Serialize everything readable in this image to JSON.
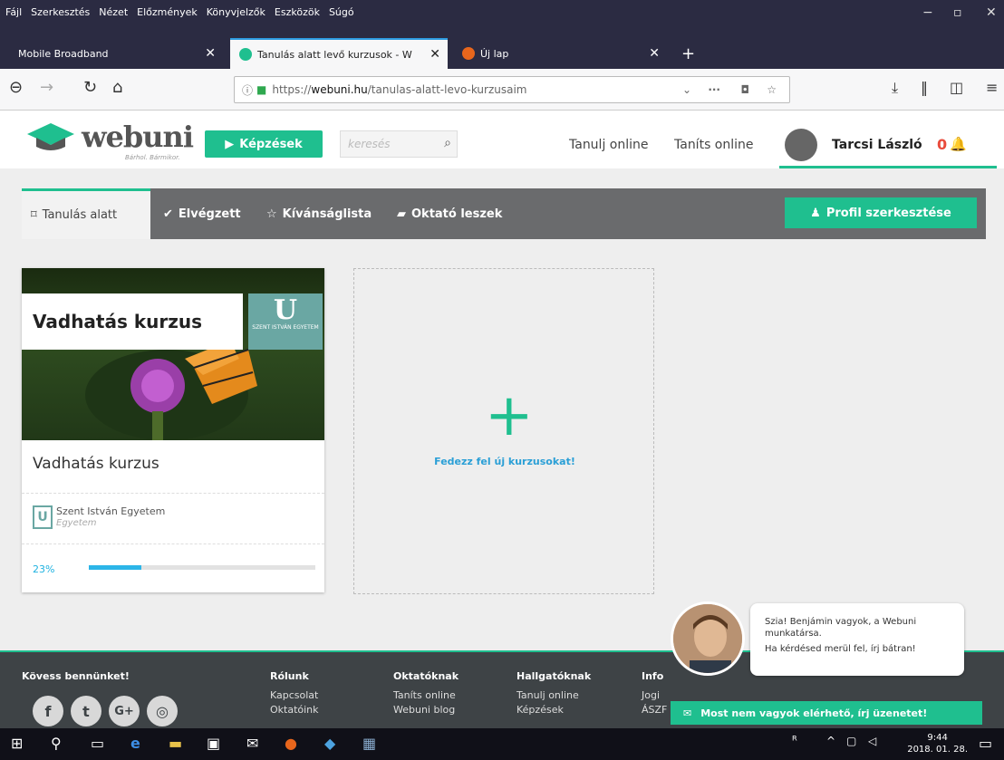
{
  "menubar": {
    "items": [
      "Fájl",
      "Szerkesztés",
      "Nézet",
      "Előzmények",
      "Könyvjelzők",
      "Eszközök",
      "Súgó"
    ],
    "minimize": "−",
    "restore": "▫",
    "close": "✕"
  },
  "tabs": [
    {
      "label": "Mobile Broadband",
      "active": false
    },
    {
      "label": "Tanulás alatt levő kurzusok - W",
      "active": true
    },
    {
      "label": "Új lap",
      "active": false
    }
  ],
  "tab_close": "✕",
  "new_tab": "+",
  "nav": {
    "url_prefix": "https://",
    "url_domain": "webuni.hu",
    "url_path": "/tanulas-alatt-levo-kurzusaim",
    "more": "···"
  },
  "site": {
    "logo": "webuni",
    "logo_sub": "Bárhol. Bármikor.",
    "kepzesek": "Képzések",
    "search_placeholder": "keresés",
    "link1": "Tanulj online",
    "link2": "Taníts online",
    "username": "Tarcsi László",
    "notif_count": "0"
  },
  "coursetabs": [
    {
      "label": "Tanulás alatt",
      "icon": "bookmark-icon"
    },
    {
      "label": "Elvégzett",
      "icon": "check-icon"
    },
    {
      "label": "Kívánságlista",
      "icon": "star-icon"
    },
    {
      "label": "Oktató leszek",
      "icon": "book-icon"
    }
  ],
  "profile_button": "Profil szerkesztése",
  "card": {
    "title": "Vadhatás kurzus",
    "name": "Vadhatás kurzus",
    "uni_logo_text": "SZENT ISTVÁN EGYETEM",
    "org": "Szent István Egyetem",
    "org_type": "Egyetem",
    "progress_label": "23%",
    "progress": 0.23
  },
  "discover": {
    "text": "Fedezz fel új kurzusokat!"
  },
  "footer": {
    "follow": "Kövess bennünket!",
    "cols": [
      {
        "title": "Rólunk",
        "links": [
          "Kapcsolat",
          "Oktatóink"
        ]
      },
      {
        "title": "Oktatóknak",
        "links": [
          "Taníts online",
          "Webuni blog"
        ]
      },
      {
        "title": "Hallgatóknak",
        "links": [
          "Tanulj online",
          "Képzések"
        ]
      },
      {
        "title": "Info",
        "links": [
          "Jogi",
          "ÁSZF"
        ]
      }
    ],
    "social": [
      "f",
      "t",
      "G+",
      "◎"
    ]
  },
  "chat": {
    "line1": "Szia! Benjámin vagyok, a Webuni munkatársa.",
    "line2": "Ha kérdésed merül fel, írj bátran!",
    "bar": "Most nem vagyok elérhető, írj üzenetet!"
  },
  "taskbar": {
    "time": "9:44",
    "date": "2018. 01. 28."
  },
  "colors": {
    "accent": "#1fbf8f",
    "link": "#2a9fd6",
    "notif": "#e94b3c"
  }
}
